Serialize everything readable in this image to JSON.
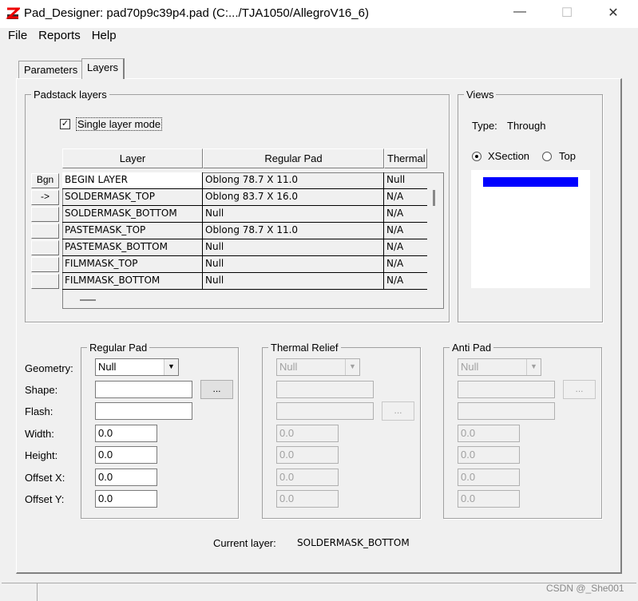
{
  "window": {
    "title": "Pad_Designer: pad70p9c39p4.pad (C:.../TJA1050/AllegroV16_6)",
    "minimize": "—",
    "maximize": "☐",
    "close": "✕"
  },
  "menu": [
    "File",
    "Reports",
    "Help"
  ],
  "tabs": [
    "Parameters",
    "Layers"
  ],
  "padstack": {
    "title": "Padstack layers",
    "single_layer_mode": "Single layer mode",
    "columns": [
      "Layer",
      "Regular Pad",
      "Thermal"
    ],
    "rows": [
      {
        "btn": "Bgn",
        "layer": "BEGIN LAYER",
        "pad": "Oblong 78.7 X 11.0",
        "thermal": "Null"
      },
      {
        "btn": "->",
        "layer": "SOLDERMASK_TOP",
        "pad": "Oblong 83.7 X 16.0",
        "thermal": "N/A"
      },
      {
        "btn": "",
        "layer": "SOLDERMASK_BOTTOM",
        "pad": "Null",
        "thermal": "N/A"
      },
      {
        "btn": "",
        "layer": "PASTEMASK_TOP",
        "pad": "Oblong 78.7 X 11.0",
        "thermal": "N/A"
      },
      {
        "btn": "",
        "layer": "PASTEMASK_BOTTOM",
        "pad": "Null",
        "thermal": "N/A"
      },
      {
        "btn": "",
        "layer": "FILMMASK_TOP",
        "pad": "Null",
        "thermal": "N/A"
      },
      {
        "btn": "",
        "layer": "FILMMASK_BOTTOM",
        "pad": "Null",
        "thermal": "N/A"
      }
    ]
  },
  "views": {
    "title": "Views",
    "type_label": "Type:",
    "type_value": "Through",
    "xsection": "XSection",
    "top": "Top",
    "color": "#0000ff"
  },
  "labels": [
    "Geometry:",
    "Shape:",
    "Flash:",
    "Width:",
    "Height:",
    "Offset X:",
    "Offset Y:"
  ],
  "regular": {
    "title": "Regular Pad",
    "geometry": "Null",
    "width": "0.0",
    "height": "0.0",
    "offx": "0.0",
    "offy": "0.0",
    "browse": "..."
  },
  "thermal": {
    "title": "Thermal Relief",
    "geometry": "Null",
    "width": "0.0",
    "height": "0.0",
    "offx": "0.0",
    "offy": "0.0",
    "browse": "..."
  },
  "anti": {
    "title": "Anti Pad",
    "geometry": "Null",
    "width": "0.0",
    "height": "0.0",
    "offx": "0.0",
    "offy": "0.0",
    "browse": "..."
  },
  "current": {
    "label": "Current layer:",
    "value": "SOLDERMASK_BOTTOM"
  },
  "watermark": "CSDN @_She001"
}
